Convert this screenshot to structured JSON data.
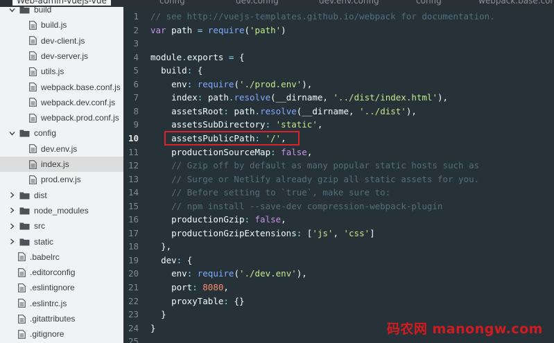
{
  "top": {
    "title": "Web-admin-vuejs-vue",
    "tabs": [
      "config",
      "dev.config",
      "dev.env.config",
      "config",
      "webpack.base.conf"
    ]
  },
  "sidebar": {
    "items": [
      {
        "label": "build",
        "type": "folder",
        "expanded": true,
        "depth": 0
      },
      {
        "label": "build.js",
        "type": "file",
        "depth": 1
      },
      {
        "label": "dev-client.js",
        "type": "file",
        "depth": 1
      },
      {
        "label": "dev-server.js",
        "type": "file",
        "depth": 1
      },
      {
        "label": "utils.js",
        "type": "file",
        "depth": 1
      },
      {
        "label": "webpack.base.conf.js",
        "type": "file",
        "depth": 1
      },
      {
        "label": "webpack.dev.conf.js",
        "type": "file",
        "depth": 1
      },
      {
        "label": "webpack.prod.conf.js",
        "type": "file",
        "depth": 1
      },
      {
        "label": "config",
        "type": "folder",
        "expanded": true,
        "depth": 0
      },
      {
        "label": "dev.env.js",
        "type": "file",
        "depth": 1
      },
      {
        "label": "index.js",
        "type": "file",
        "depth": 1,
        "selected": true
      },
      {
        "label": "prod.env.js",
        "type": "file",
        "depth": 1
      },
      {
        "label": "dist",
        "type": "folder",
        "expanded": false,
        "depth": 0
      },
      {
        "label": "node_modules",
        "type": "folder",
        "expanded": false,
        "depth": 0
      },
      {
        "label": "src",
        "type": "folder",
        "expanded": false,
        "depth": 0
      },
      {
        "label": "static",
        "type": "folder",
        "expanded": false,
        "depth": 0
      },
      {
        "label": ".babelrc",
        "type": "file",
        "depth": 0
      },
      {
        "label": ".editorconfig",
        "type": "file",
        "depth": 0
      },
      {
        "label": ".eslintignore",
        "type": "file",
        "depth": 0
      },
      {
        "label": ".eslintrc.js",
        "type": "file",
        "depth": 0
      },
      {
        "label": ".gitattributes",
        "type": "file",
        "depth": 0
      },
      {
        "label": ".gitignore",
        "type": "file",
        "depth": 0
      }
    ]
  },
  "editor": {
    "active_line": 10,
    "highlighted_line": 10,
    "lines": [
      {
        "n": "1",
        "tokens": [
          [
            "c",
            "// see http://vuejs-templates.github.io/webpack for documentation."
          ]
        ]
      },
      {
        "n": "2",
        "tokens": [
          [
            "k",
            "var"
          ],
          [
            "t",
            " "
          ],
          [
            "t",
            "path"
          ],
          [
            "o",
            " = "
          ],
          [
            "f",
            "require"
          ],
          [
            "t",
            "("
          ],
          [
            "s",
            "'path'"
          ],
          [
            "t",
            ")"
          ]
        ]
      },
      {
        "n": "3",
        "tokens": []
      },
      {
        "n": "4",
        "tokens": [
          [
            "t",
            "module"
          ],
          [
            "o",
            "."
          ],
          [
            "t",
            "exports"
          ],
          [
            "o",
            " = "
          ],
          [
            "t",
            "{"
          ]
        ]
      },
      {
        "n": "5",
        "tokens": [
          [
            "t",
            "  "
          ],
          [
            "t",
            "build"
          ],
          [
            "o",
            ": "
          ],
          [
            "t",
            "{"
          ]
        ]
      },
      {
        "n": "6",
        "tokens": [
          [
            "t",
            "    "
          ],
          [
            "t",
            "env"
          ],
          [
            "o",
            ": "
          ],
          [
            "f",
            "require"
          ],
          [
            "t",
            "("
          ],
          [
            "s",
            "'./prod.env'"
          ],
          [
            "t",
            "),"
          ]
        ]
      },
      {
        "n": "7",
        "tokens": [
          [
            "t",
            "    "
          ],
          [
            "t",
            "index"
          ],
          [
            "o",
            ": "
          ],
          [
            "t",
            "path"
          ],
          [
            "o",
            "."
          ],
          [
            "f",
            "resolve"
          ],
          [
            "t",
            "("
          ],
          [
            "t",
            "__dirname"
          ],
          [
            "t",
            ", "
          ],
          [
            "s",
            "'../dist/index.html'"
          ],
          [
            "t",
            "),"
          ]
        ]
      },
      {
        "n": "8",
        "tokens": [
          [
            "t",
            "    "
          ],
          [
            "t",
            "assetsRoot"
          ],
          [
            "o",
            ": "
          ],
          [
            "t",
            "path"
          ],
          [
            "o",
            "."
          ],
          [
            "f",
            "resolve"
          ],
          [
            "t",
            "("
          ],
          [
            "t",
            "__dirname"
          ],
          [
            "t",
            ", "
          ],
          [
            "s",
            "'../dist'"
          ],
          [
            "t",
            "),"
          ]
        ]
      },
      {
        "n": "9",
        "tokens": [
          [
            "t",
            "    "
          ],
          [
            "t",
            "assetsSubDirectory"
          ],
          [
            "o",
            ": "
          ],
          [
            "s",
            "'static'"
          ],
          [
            "t",
            ","
          ]
        ]
      },
      {
        "n": "10",
        "tokens": [
          [
            "t",
            "    "
          ],
          [
            "t",
            "assetsPublicPath"
          ],
          [
            "o",
            ": "
          ],
          [
            "s",
            "'/'"
          ],
          [
            "t",
            ","
          ]
        ]
      },
      {
        "n": "11",
        "tokens": [
          [
            "t",
            "    "
          ],
          [
            "t",
            "productionSourceMap"
          ],
          [
            "o",
            ": "
          ],
          [
            "k",
            "false"
          ],
          [
            "t",
            ","
          ]
        ]
      },
      {
        "n": "12",
        "tokens": [
          [
            "t",
            "    "
          ],
          [
            "c",
            "// Gzip off by default as many popular static hosts such as"
          ]
        ]
      },
      {
        "n": "13",
        "tokens": [
          [
            "t",
            "    "
          ],
          [
            "c",
            "// Surge or Netlify already gzip all static assets for you."
          ]
        ]
      },
      {
        "n": "14",
        "tokens": [
          [
            "t",
            "    "
          ],
          [
            "c",
            "// Before setting to `true`, make sure to:"
          ]
        ]
      },
      {
        "n": "15",
        "tokens": [
          [
            "t",
            "    "
          ],
          [
            "c",
            "// npm install --save-dev compression-webpack-plugin"
          ]
        ]
      },
      {
        "n": "16",
        "tokens": [
          [
            "t",
            "    "
          ],
          [
            "t",
            "productionGzip"
          ],
          [
            "o",
            ": "
          ],
          [
            "k",
            "false"
          ],
          [
            "t",
            ","
          ]
        ]
      },
      {
        "n": "17",
        "tokens": [
          [
            "t",
            "    "
          ],
          [
            "t",
            "productionGzipExtensions"
          ],
          [
            "o",
            ": "
          ],
          [
            "t",
            "["
          ],
          [
            "s",
            "'js'"
          ],
          [
            "t",
            ", "
          ],
          [
            "s",
            "'css'"
          ],
          [
            "t",
            "]"
          ]
        ]
      },
      {
        "n": "18",
        "tokens": [
          [
            "t",
            "  "
          ],
          [
            "t",
            "},"
          ]
        ]
      },
      {
        "n": "19",
        "tokens": [
          [
            "t",
            "  "
          ],
          [
            "t",
            "dev"
          ],
          [
            "o",
            ": "
          ],
          [
            "t",
            "{"
          ]
        ]
      },
      {
        "n": "20",
        "tokens": [
          [
            "t",
            "    "
          ],
          [
            "t",
            "env"
          ],
          [
            "o",
            ": "
          ],
          [
            "f",
            "require"
          ],
          [
            "t",
            "("
          ],
          [
            "s",
            "'./dev.env'"
          ],
          [
            "t",
            "),"
          ]
        ]
      },
      {
        "n": "21",
        "tokens": [
          [
            "t",
            "    "
          ],
          [
            "t",
            "port"
          ],
          [
            "o",
            ": "
          ],
          [
            "n",
            "8080"
          ],
          [
            "t",
            ","
          ]
        ]
      },
      {
        "n": "22",
        "tokens": [
          [
            "t",
            "    "
          ],
          [
            "t",
            "proxyTable"
          ],
          [
            "o",
            ": "
          ],
          [
            "t",
            "{}"
          ]
        ]
      },
      {
        "n": "23",
        "tokens": [
          [
            "t",
            "  "
          ],
          [
            "t",
            "}"
          ]
        ]
      },
      {
        "n": "24",
        "tokens": [
          [
            "t",
            "}"
          ]
        ]
      },
      {
        "n": "25",
        "tokens": []
      }
    ]
  },
  "watermark": {
    "text": "码农网 manongw.com"
  },
  "colors": {
    "editor_bg": "#263238",
    "sidebar_bg": "#f1f2f3",
    "highlight_box": "#d9232a",
    "watermark": "#e01a1f"
  }
}
